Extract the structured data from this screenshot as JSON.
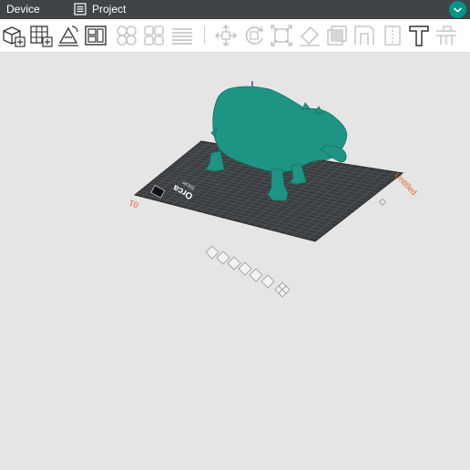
{
  "topbar": {
    "device_tab": "Device",
    "project_tab": "Project",
    "project_icon": "list-icon",
    "collapse_icon": "chevron-down-icon"
  },
  "toolbar": {
    "left_tools": [
      "add-object-icon",
      "arrange-grid-icon",
      "auto-orient-icon",
      "layout-icon"
    ],
    "middle_tools": [
      "split-objects-icon",
      "split-parts-icon",
      "layers-icon"
    ],
    "right_tools": [
      "move-icon",
      "rotate-icon",
      "scale-icon",
      "paint-icon",
      "cut-icon",
      "measure-icon",
      "seam-icon",
      "text-icon",
      "support-icon"
    ]
  },
  "plate": {
    "name": "Untitled",
    "index": "01",
    "logo_text": "Orca",
    "logo_subtext": "Slicer",
    "plate_tools": [
      "arrange-plate-icon",
      "orient-plate-icon",
      "lock-plate-icon",
      "settings-plate-icon",
      "layout-plate-icon",
      "select-all-icon",
      "close-plate-icon"
    ]
  },
  "model": {
    "name": "hippo",
    "color": "#1e9484"
  },
  "colors": {
    "accent": "#009688",
    "label": "#e8622b",
    "bed": "#3c3f42",
    "topbar": "#3f4448"
  }
}
